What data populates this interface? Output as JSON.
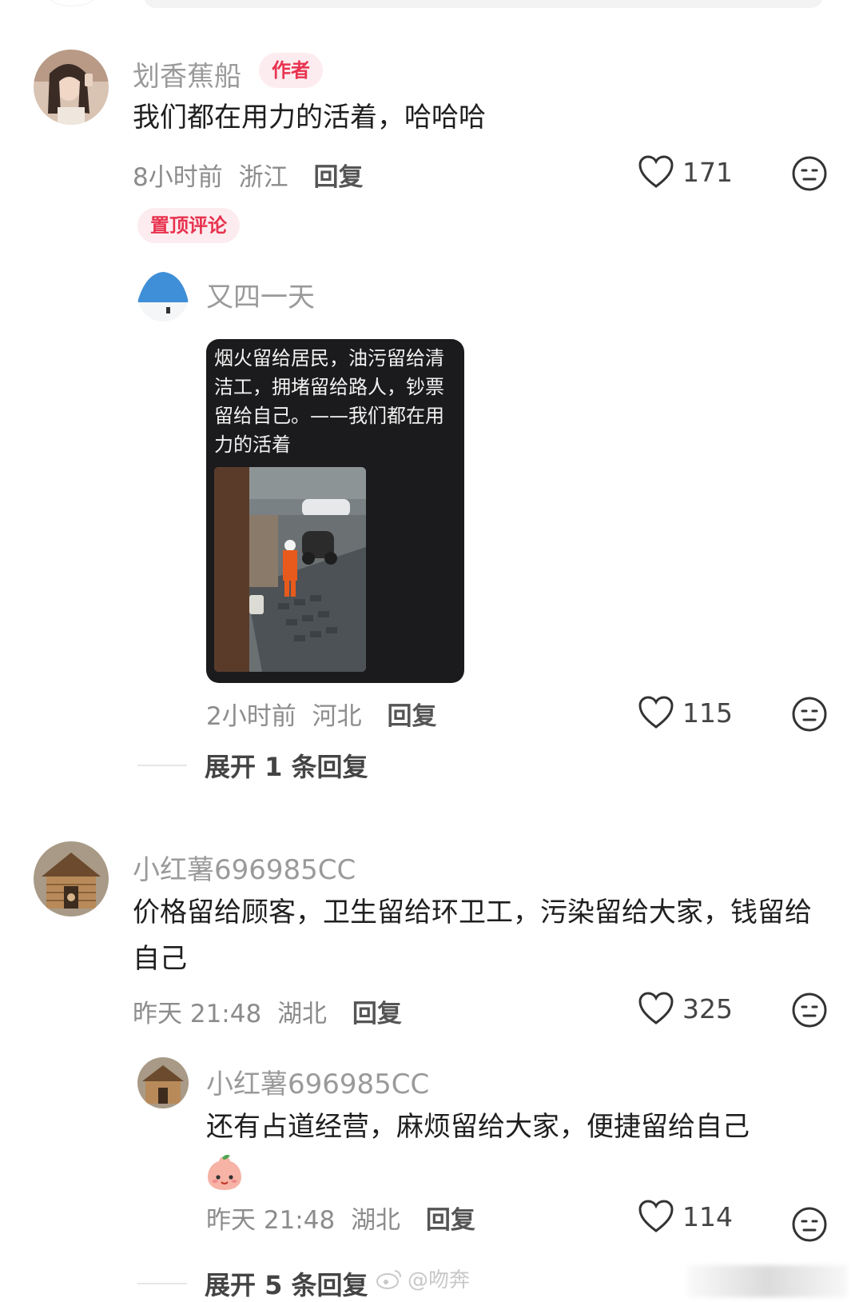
{
  "comments": [
    {
      "username": "划香蕉船",
      "author_badge": "作者",
      "text": "我们都在用力的活着，哈哈哈",
      "time": "8小时前",
      "location": "浙江",
      "reply_label": "回复",
      "likes": "171",
      "pinned_badge": "置顶评论",
      "reply": {
        "username": "又四一天",
        "image_caption": "烟火留给居民，油污留给清洁工，拥堵留给路人，钞票留给自己。——我们都在用力的活着",
        "time": "2小时前",
        "location": "河北",
        "reply_label": "回复",
        "likes": "115"
      },
      "expand_label": "展开 1 条回复"
    },
    {
      "username": "小红薯696985CC",
      "text": "价格留给顾客，卫生留给环卫工，污染留给大家，钱留给自己",
      "time": "昨天 21:48",
      "location": "湖北",
      "reply_label": "回复",
      "likes": "325",
      "reply": {
        "username": "小红薯696985CC",
        "text": "还有占道经营，麻烦留给大家，便捷留给自己",
        "emoji": "peach-face-emoji",
        "time": "昨天 21:48",
        "location": "湖北",
        "reply_label": "回复",
        "likes": "114"
      },
      "expand_label": "展开 5 条回复"
    }
  ],
  "watermark": "@吻奔",
  "icons": {
    "like": "heart-outline-icon",
    "dislike": "neutral-face-icon"
  },
  "colors": {
    "badge_bg": "#fdecef",
    "badge_text": "#e8334f",
    "muted_text": "#8c8c8c"
  }
}
